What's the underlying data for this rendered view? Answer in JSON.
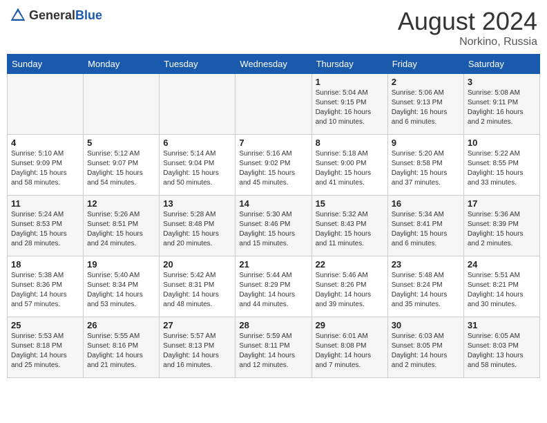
{
  "header": {
    "logo_general": "General",
    "logo_blue": "Blue",
    "month_year": "August 2024",
    "location": "Norkino, Russia"
  },
  "weekdays": [
    "Sunday",
    "Monday",
    "Tuesday",
    "Wednesday",
    "Thursday",
    "Friday",
    "Saturday"
  ],
  "weeks": [
    [
      {
        "day": "",
        "info": ""
      },
      {
        "day": "",
        "info": ""
      },
      {
        "day": "",
        "info": ""
      },
      {
        "day": "",
        "info": ""
      },
      {
        "day": "1",
        "info": "Sunrise: 5:04 AM\nSunset: 9:15 PM\nDaylight: 16 hours\nand 10 minutes."
      },
      {
        "day": "2",
        "info": "Sunrise: 5:06 AM\nSunset: 9:13 PM\nDaylight: 16 hours\nand 6 minutes."
      },
      {
        "day": "3",
        "info": "Sunrise: 5:08 AM\nSunset: 9:11 PM\nDaylight: 16 hours\nand 2 minutes."
      }
    ],
    [
      {
        "day": "4",
        "info": "Sunrise: 5:10 AM\nSunset: 9:09 PM\nDaylight: 15 hours\nand 58 minutes."
      },
      {
        "day": "5",
        "info": "Sunrise: 5:12 AM\nSunset: 9:07 PM\nDaylight: 15 hours\nand 54 minutes."
      },
      {
        "day": "6",
        "info": "Sunrise: 5:14 AM\nSunset: 9:04 PM\nDaylight: 15 hours\nand 50 minutes."
      },
      {
        "day": "7",
        "info": "Sunrise: 5:16 AM\nSunset: 9:02 PM\nDaylight: 15 hours\nand 45 minutes."
      },
      {
        "day": "8",
        "info": "Sunrise: 5:18 AM\nSunset: 9:00 PM\nDaylight: 15 hours\nand 41 minutes."
      },
      {
        "day": "9",
        "info": "Sunrise: 5:20 AM\nSunset: 8:58 PM\nDaylight: 15 hours\nand 37 minutes."
      },
      {
        "day": "10",
        "info": "Sunrise: 5:22 AM\nSunset: 8:55 PM\nDaylight: 15 hours\nand 33 minutes."
      }
    ],
    [
      {
        "day": "11",
        "info": "Sunrise: 5:24 AM\nSunset: 8:53 PM\nDaylight: 15 hours\nand 28 minutes."
      },
      {
        "day": "12",
        "info": "Sunrise: 5:26 AM\nSunset: 8:51 PM\nDaylight: 15 hours\nand 24 minutes."
      },
      {
        "day": "13",
        "info": "Sunrise: 5:28 AM\nSunset: 8:48 PM\nDaylight: 15 hours\nand 20 minutes."
      },
      {
        "day": "14",
        "info": "Sunrise: 5:30 AM\nSunset: 8:46 PM\nDaylight: 15 hours\nand 15 minutes."
      },
      {
        "day": "15",
        "info": "Sunrise: 5:32 AM\nSunset: 8:43 PM\nDaylight: 15 hours\nand 11 minutes."
      },
      {
        "day": "16",
        "info": "Sunrise: 5:34 AM\nSunset: 8:41 PM\nDaylight: 15 hours\nand 6 minutes."
      },
      {
        "day": "17",
        "info": "Sunrise: 5:36 AM\nSunset: 8:39 PM\nDaylight: 15 hours\nand 2 minutes."
      }
    ],
    [
      {
        "day": "18",
        "info": "Sunrise: 5:38 AM\nSunset: 8:36 PM\nDaylight: 14 hours\nand 57 minutes."
      },
      {
        "day": "19",
        "info": "Sunrise: 5:40 AM\nSunset: 8:34 PM\nDaylight: 14 hours\nand 53 minutes."
      },
      {
        "day": "20",
        "info": "Sunrise: 5:42 AM\nSunset: 8:31 PM\nDaylight: 14 hours\nand 48 minutes."
      },
      {
        "day": "21",
        "info": "Sunrise: 5:44 AM\nSunset: 8:29 PM\nDaylight: 14 hours\nand 44 minutes."
      },
      {
        "day": "22",
        "info": "Sunrise: 5:46 AM\nSunset: 8:26 PM\nDaylight: 14 hours\nand 39 minutes."
      },
      {
        "day": "23",
        "info": "Sunrise: 5:48 AM\nSunset: 8:24 PM\nDaylight: 14 hours\nand 35 minutes."
      },
      {
        "day": "24",
        "info": "Sunrise: 5:51 AM\nSunset: 8:21 PM\nDaylight: 14 hours\nand 30 minutes."
      }
    ],
    [
      {
        "day": "25",
        "info": "Sunrise: 5:53 AM\nSunset: 8:18 PM\nDaylight: 14 hours\nand 25 minutes."
      },
      {
        "day": "26",
        "info": "Sunrise: 5:55 AM\nSunset: 8:16 PM\nDaylight: 14 hours\nand 21 minutes."
      },
      {
        "day": "27",
        "info": "Sunrise: 5:57 AM\nSunset: 8:13 PM\nDaylight: 14 hours\nand 16 minutes."
      },
      {
        "day": "28",
        "info": "Sunrise: 5:59 AM\nSunset: 8:11 PM\nDaylight: 14 hours\nand 12 minutes."
      },
      {
        "day": "29",
        "info": "Sunrise: 6:01 AM\nSunset: 8:08 PM\nDaylight: 14 hours\nand 7 minutes."
      },
      {
        "day": "30",
        "info": "Sunrise: 6:03 AM\nSunset: 8:05 PM\nDaylight: 14 hours\nand 2 minutes."
      },
      {
        "day": "31",
        "info": "Sunrise: 6:05 AM\nSunset: 8:03 PM\nDaylight: 13 hours\nand 58 minutes."
      }
    ]
  ]
}
